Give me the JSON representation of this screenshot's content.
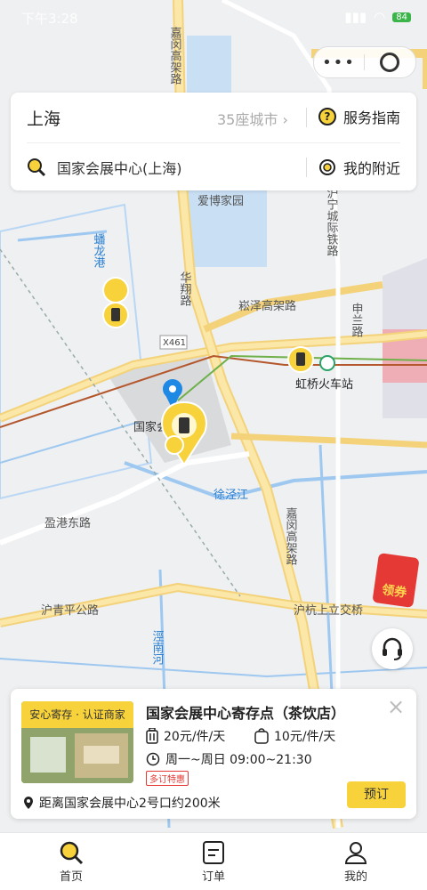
{
  "status": {
    "time": "下午3:28",
    "battery": "84"
  },
  "search": {
    "city": "上海",
    "city_count": "35座城市",
    "guide_label": "服务指南",
    "query": "国家会展中心(上海)",
    "nearby_label": "我的附近"
  },
  "map": {
    "labels": {
      "jiamin1": "嘉闵高架路",
      "aibo": "爱博家园",
      "panlong": "蟠龙港",
      "huxiang": "华翔路",
      "songze": "崧泽高架路",
      "shenlan": "申兰路",
      "huning": "沪宁城际铁路",
      "x461": "X461",
      "hongqiao": "虹桥火车站",
      "guojia": "国家会展中心",
      "xujing": "徐泾江",
      "yingang": "盈港东路",
      "jiamin2": "嘉闵高架路",
      "huqingping": "沪青平公路",
      "huhang": "沪杭上立交桥",
      "jiangnan": "涇南河"
    }
  },
  "coupon": {
    "label": "领券"
  },
  "store": {
    "badge": "安心寄存 · 认证商家",
    "name": "国家会展中心寄存点（茶饮店）",
    "price_luggage": "20元/件/天",
    "price_bag": "10元/件/天",
    "hours": "周一~周日 09:00~21:30",
    "tag": "多订特惠",
    "distance": "距离国家会展中心2号口约200米",
    "book_label": "预订"
  },
  "tabs": [
    {
      "label": "首页"
    },
    {
      "label": "订单"
    },
    {
      "label": "我的"
    }
  ],
  "colors": {
    "accent": "#f7d23a",
    "brand_blue": "#1e88e5",
    "map_bg": "#eef0f2"
  }
}
